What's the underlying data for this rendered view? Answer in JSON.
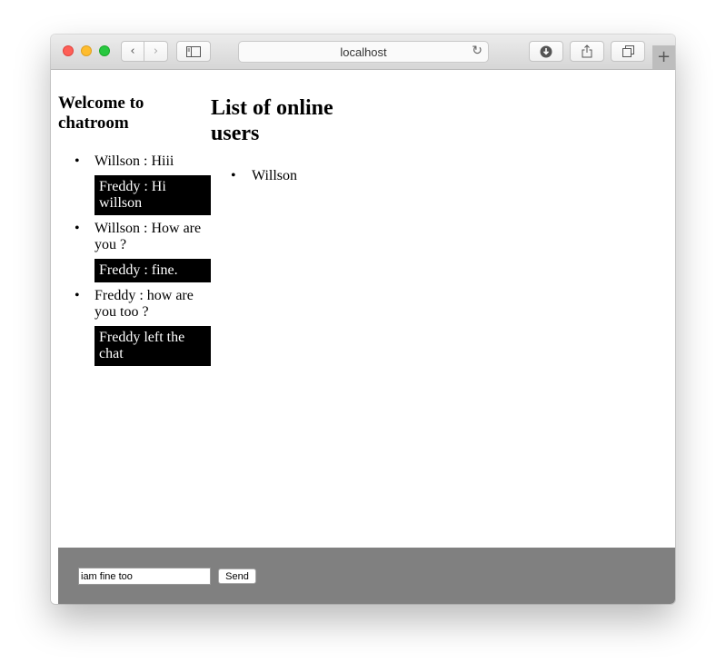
{
  "browser": {
    "url": "localhost",
    "icons": {
      "back": "chevron-left-icon",
      "forward": "chevron-right-icon",
      "sidebar": "sidebar-icon",
      "reload": "reload-icon",
      "download": "download-icon",
      "share": "share-icon",
      "tabs": "tabs-icon",
      "new_tab": "plus-icon"
    }
  },
  "chat": {
    "heading": "Welcome to chatroom",
    "messages": [
      {
        "text": "Willson : Hiii",
        "type": "mine"
      },
      {
        "text": "Freddy : Hi willson",
        "type": "other"
      },
      {
        "text": "Willson : How are you ?",
        "type": "mine"
      },
      {
        "text": "Freddy : fine.",
        "type": "other"
      },
      {
        "text": "Freddy : how are you too ?",
        "type": "mine"
      },
      {
        "text": "Freddy left the chat",
        "type": "other"
      }
    ]
  },
  "users": {
    "heading": "List of online users",
    "list": [
      "Willson"
    ]
  },
  "composer": {
    "input_value": "iam fine too",
    "send_label": "Send"
  }
}
